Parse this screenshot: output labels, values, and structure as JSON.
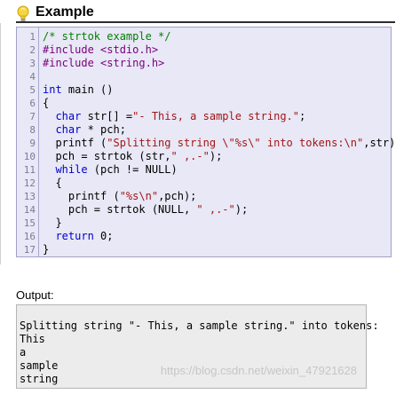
{
  "section": {
    "title": "Example"
  },
  "code": {
    "line_numbers": [
      "1",
      "2",
      "3",
      "4",
      "5",
      "6",
      "7",
      "8",
      "9",
      "10",
      "11",
      "12",
      "13",
      "14",
      "15",
      "16",
      "17"
    ],
    "lines": [
      {
        "n": "1",
        "segs": [
          {
            "t": "/* strtok example */",
            "c": "cmt"
          }
        ]
      },
      {
        "n": "2",
        "segs": [
          {
            "t": "#include <stdio.h>",
            "c": "pp"
          }
        ]
      },
      {
        "n": "3",
        "segs": [
          {
            "t": "#include <string.h>",
            "c": "pp"
          }
        ]
      },
      {
        "n": "4",
        "segs": [
          {
            "t": "",
            "c": ""
          }
        ]
      },
      {
        "n": "5",
        "segs": [
          {
            "t": "int",
            "c": "kw"
          },
          {
            "t": " main ()",
            "c": ""
          }
        ]
      },
      {
        "n": "6",
        "segs": [
          {
            "t": "{",
            "c": ""
          }
        ]
      },
      {
        "n": "7",
        "segs": [
          {
            "t": "  char",
            "c": "kw"
          },
          {
            "t": " str[] =",
            "c": ""
          },
          {
            "t": "\"- This, a sample string.\"",
            "c": "str"
          },
          {
            "t": ";",
            "c": ""
          }
        ]
      },
      {
        "n": "8",
        "segs": [
          {
            "t": "  char",
            "c": "kw"
          },
          {
            "t": " * pch;",
            "c": ""
          }
        ]
      },
      {
        "n": "9",
        "segs": [
          {
            "t": "  printf (",
            "c": ""
          },
          {
            "t": "\"Splitting string \\\"%s\\\" into tokens:\\n\"",
            "c": "str"
          },
          {
            "t": ",str);",
            "c": ""
          }
        ]
      },
      {
        "n": "10",
        "segs": [
          {
            "t": "  pch = strtok (str,",
            "c": ""
          },
          {
            "t": "\" ,.-\"",
            "c": "str"
          },
          {
            "t": ");",
            "c": ""
          }
        ]
      },
      {
        "n": "11",
        "segs": [
          {
            "t": "  while",
            "c": "kw"
          },
          {
            "t": " (pch != NULL)",
            "c": ""
          }
        ]
      },
      {
        "n": "12",
        "segs": [
          {
            "t": "  {",
            "c": ""
          }
        ]
      },
      {
        "n": "13",
        "segs": [
          {
            "t": "    printf (",
            "c": ""
          },
          {
            "t": "\"%s\\n\"",
            "c": "str"
          },
          {
            "t": ",pch);",
            "c": ""
          }
        ]
      },
      {
        "n": "14",
        "segs": [
          {
            "t": "    pch = strtok (NULL, ",
            "c": ""
          },
          {
            "t": "\" ,.-\"",
            "c": "str"
          },
          {
            "t": ");",
            "c": ""
          }
        ]
      },
      {
        "n": "15",
        "segs": [
          {
            "t": "  }",
            "c": ""
          }
        ]
      },
      {
        "n": "16",
        "segs": [
          {
            "t": "  return",
            "c": "kw"
          },
          {
            "t": " 0;",
            "c": ""
          }
        ]
      },
      {
        "n": "17",
        "segs": [
          {
            "t": "}",
            "c": ""
          }
        ]
      }
    ]
  },
  "output": {
    "label": "Output:",
    "lines": [
      "Splitting string \"- This, a sample string.\" into tokens:",
      "This",
      "a",
      "sample",
      "string"
    ]
  },
  "watermark": "https://blog.csdn.net/weixin_47921628"
}
